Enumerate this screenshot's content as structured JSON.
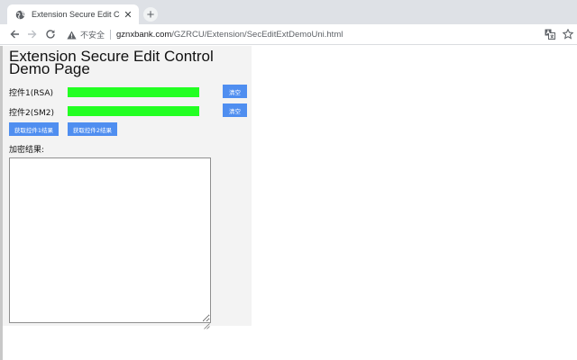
{
  "browser": {
    "tab": {
      "title": "Extension Secure Edit Control",
      "close_glyph": "✕",
      "favicon": "globe-icon"
    },
    "new_tab_glyph": "+",
    "toolbar": {
      "back_icon": "arrow-left-icon",
      "forward_icon": "arrow-right-icon",
      "reload_icon": "reload-icon",
      "security_icon": "warning-triangle-icon",
      "security_label": "不安全",
      "url_host": "gznxbank.com",
      "url_path": "/GZRCU/Extension/SecEditExtDemoUni.html",
      "translate_icon": "translate-icon",
      "bookmark_icon": "star-icon"
    }
  },
  "page": {
    "title": "Extension Secure Edit Control Demo Page",
    "rows": [
      {
        "label": "控件1(RSA)",
        "clear_label": "清空"
      },
      {
        "label": "控件2(SM2)",
        "clear_label": "清空"
      }
    ],
    "get_result_1_label": "获取控件1结果",
    "get_result_2_label": "获取控件2结果",
    "result_label": "加密结果:",
    "result_value": ""
  },
  "colors": {
    "secure_edit_fill": "#22ff22",
    "button_blue": "#4f8ef0",
    "panel_bg": "#f3f3f3",
    "tabstrip_bg": "#dee1e6"
  }
}
